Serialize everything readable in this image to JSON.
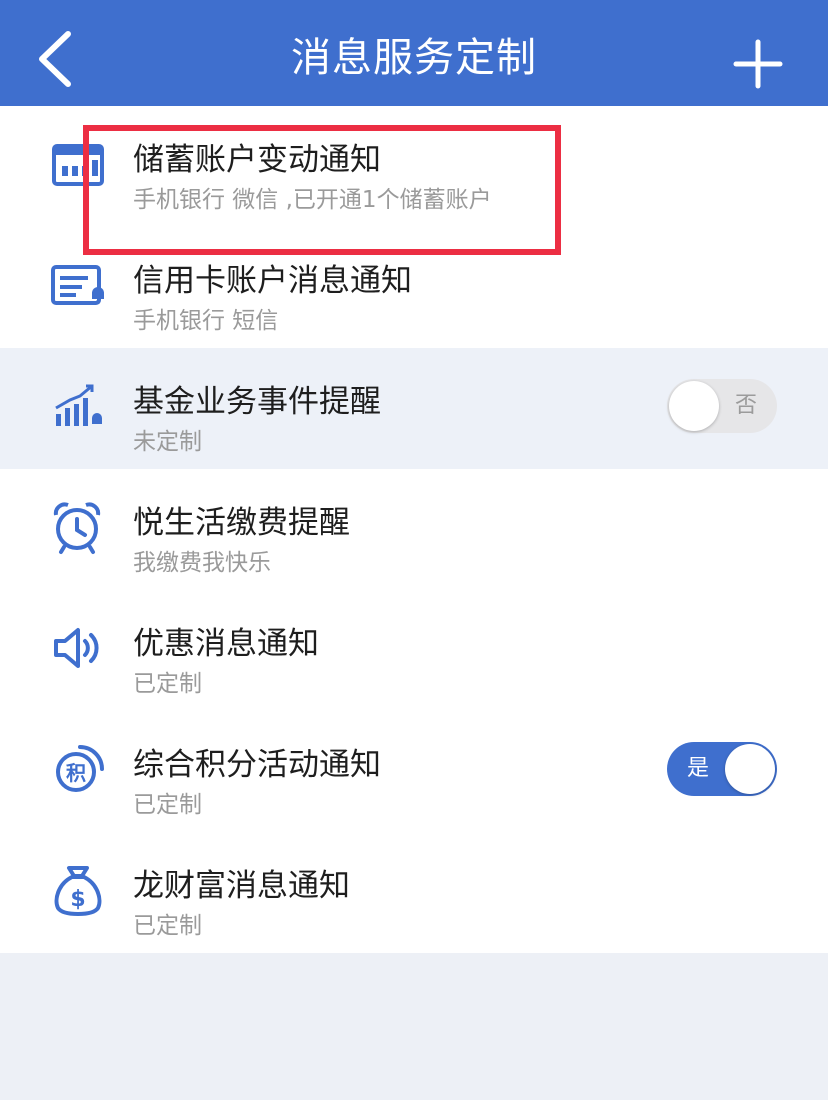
{
  "header": {
    "title": "消息服务定制",
    "back_icon": "chevron-left-icon",
    "add_icon": "plus-icon"
  },
  "colors": {
    "header_bg": "#3f6fce",
    "accent_blue": "#3f6fce",
    "highlight_red": "#ec2e43"
  },
  "items": [
    {
      "icon": "savings-card-icon",
      "name": "储蓄账户变动通知",
      "desc": "手机银行 微信 ,已开通1个储蓄账户",
      "highlighted": true
    },
    {
      "icon": "credit-card-bill-icon",
      "name": "信用卡账户消息通知",
      "desc": "手机银行 短信"
    },
    {
      "icon": "fund-chart-icon",
      "name": "基金业务事件提醒",
      "desc": "未定制",
      "toggle": {
        "state": "off",
        "label": "否"
      }
    },
    {
      "icon": "alarm-clock-icon",
      "name": "悦生活缴费提醒",
      "desc": "我缴费我快乐"
    },
    {
      "icon": "speaker-icon",
      "name": "优惠消息通知",
      "desc": "已定制"
    },
    {
      "icon": "points-badge-icon",
      "name": "综合积分活动通知",
      "desc": "已定制",
      "badge_text": "积",
      "toggle": {
        "state": "on",
        "label": "是"
      }
    },
    {
      "icon": "money-bag-icon",
      "name": "龙财富消息通知",
      "desc": "已定制"
    }
  ]
}
